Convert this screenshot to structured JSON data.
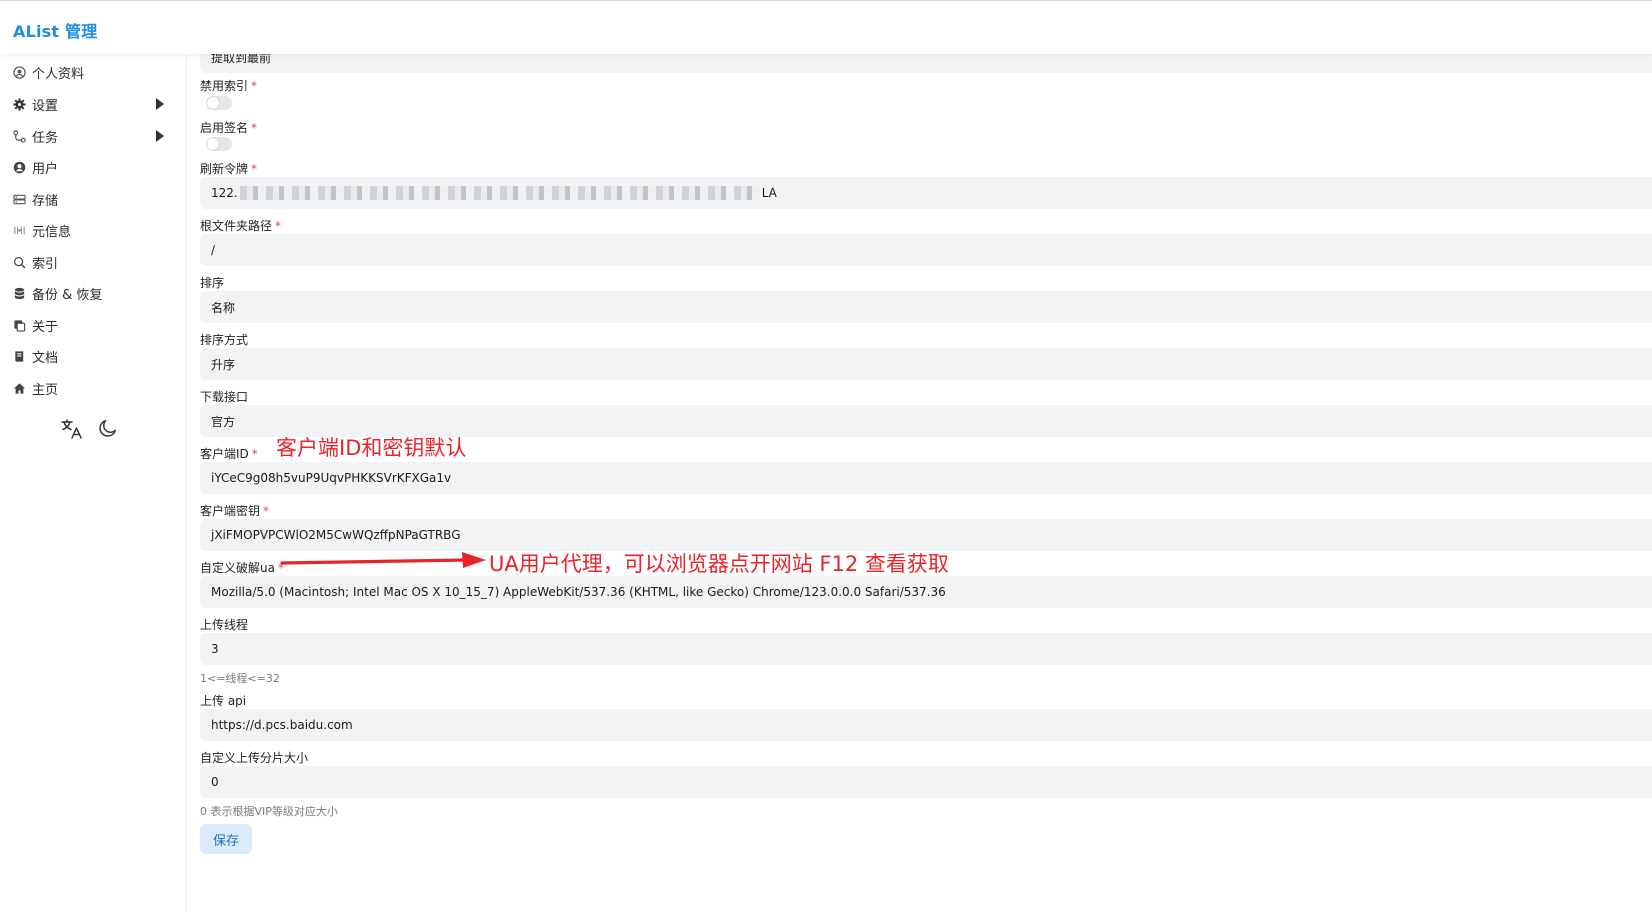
{
  "app": {
    "title": "AList 管理"
  },
  "sidebar": {
    "items": [
      {
        "label": "个人资料",
        "icon": "user-circle-icon"
      },
      {
        "label": "设置",
        "icon": "gear-icon",
        "expandable": true
      },
      {
        "label": "任务",
        "icon": "task-flow-icon",
        "expandable": true
      },
      {
        "label": "用户",
        "icon": "user-icon"
      },
      {
        "label": "存储",
        "icon": "storage-icon"
      },
      {
        "label": "元信息",
        "icon": "meta-icon"
      },
      {
        "label": "索引",
        "icon": "search-icon"
      },
      {
        "label": "备份 & 恢复",
        "icon": "database-icon"
      },
      {
        "label": "关于",
        "icon": "copy-icon"
      },
      {
        "label": "文档",
        "icon": "book-icon"
      },
      {
        "label": "主页",
        "icon": "home-icon"
      }
    ],
    "tools": {
      "language_icon": "translate-icon",
      "theme_icon": "moon-icon"
    }
  },
  "form": {
    "top_value": "提取到最前",
    "disable_index": {
      "label": "禁用索引",
      "enabled": false
    },
    "enable_sign": {
      "label": "启用签名",
      "enabled": false
    },
    "refresh_token": {
      "label": "刷新令牌",
      "value_start": "122.",
      "value_end": "LA"
    },
    "root_folder_path": {
      "label": "根文件夹路径",
      "value": "/"
    },
    "order_by": {
      "label": "排序",
      "value": "名称"
    },
    "order_direction": {
      "label": "排序方式",
      "value": "升序"
    },
    "download_api": {
      "label": "下载接口",
      "value": "官方"
    },
    "client_id": {
      "label": "客户端ID",
      "value": "iYCeC9g08h5vuP9UqvPHKKSVrKFXGa1v"
    },
    "client_secret": {
      "label": "客户端密钥",
      "value": "jXiFMOPVPCWlO2M5CwWQzffpNPaGTRBG"
    },
    "custom_crack_ua": {
      "label": "自定义破解ua",
      "value": "Mozilla/5.0 (Macintosh; Intel Mac OS X 10_15_7) AppleWebKit/537.36 (KHTML, like Gecko) Chrome/123.0.0.0 Safari/537.36"
    },
    "upload_thread": {
      "label": "上传线程",
      "value": "3",
      "helper": "1<=线程<=32"
    },
    "upload_api": {
      "label": "上传 api",
      "value": "https://d.pcs.baidu.com"
    },
    "upload_slice_size": {
      "label": "自定义上传分片大小",
      "value": "0",
      "helper": "0 表示根据VIP等级对应大小"
    },
    "save_label": "保存"
  },
  "annotations": {
    "client_note": "客户端ID和密钥默认",
    "ua_note": "UA用户代理，可以浏览器点开网站 F12 查看获取"
  },
  "colors": {
    "brand": "#1a8ee8",
    "required": "#e5484d",
    "annotation": "#e8232a",
    "input_bg": "#f1f3f5"
  }
}
